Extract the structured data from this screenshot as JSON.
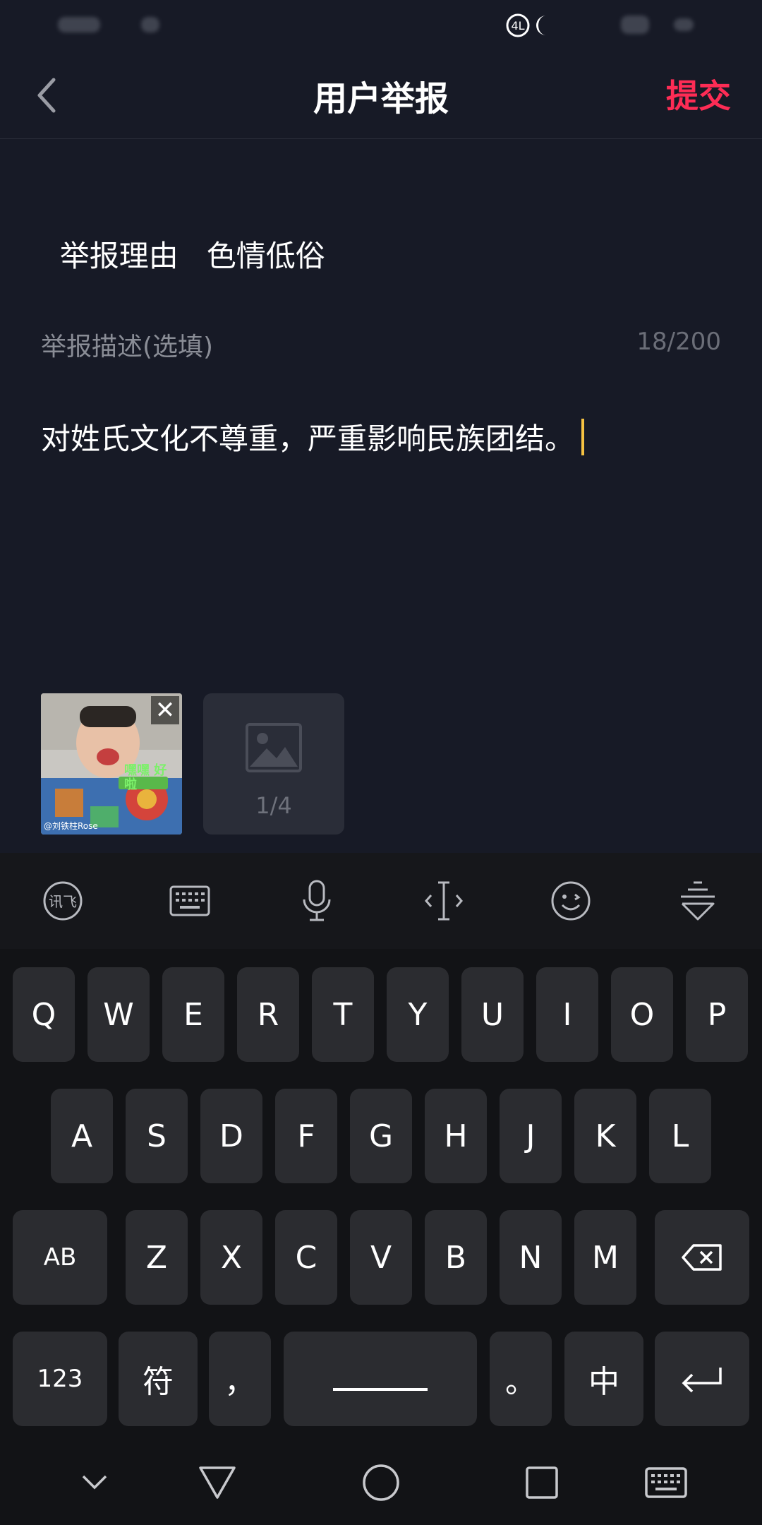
{
  "header": {
    "title": "用户举报",
    "submit_label": "提交"
  },
  "reason": {
    "label": "举报理由",
    "value": "色情低俗"
  },
  "description": {
    "label": "举报描述(选填)",
    "count": "18/200",
    "text": "对姓氏文化不尊重，严重影响民族团结。"
  },
  "images": {
    "thumb_overlay_text": "嘿嘿 好啦",
    "thumb_caption": "@刘铁柱Rose",
    "add_count": "1/4"
  },
  "keyboard": {
    "toolbar": [
      "xunfei-icon",
      "keyboard-icon",
      "microphone-icon",
      "cursor-move-icon",
      "emoji-icon",
      "hide-keyboard-icon"
    ],
    "row1": [
      "Q",
      "W",
      "E",
      "R",
      "T",
      "Y",
      "U",
      "I",
      "O",
      "P"
    ],
    "row2": [
      "A",
      "S",
      "D",
      "F",
      "G",
      "H",
      "J",
      "K",
      "L"
    ],
    "row3": [
      "Z",
      "X",
      "C",
      "V",
      "B",
      "N",
      "M"
    ],
    "shift_label": "AB",
    "num_label": "123",
    "symbol_label": "符",
    "comma_label": "，",
    "period_label": "。",
    "lang_label": "中",
    "colors": {
      "key_bg": "#2b2c30",
      "kb_bg": "#121316"
    }
  },
  "colors": {
    "background": "#171a26",
    "accent": "#fe2c55",
    "cursor": "#f5c242"
  }
}
